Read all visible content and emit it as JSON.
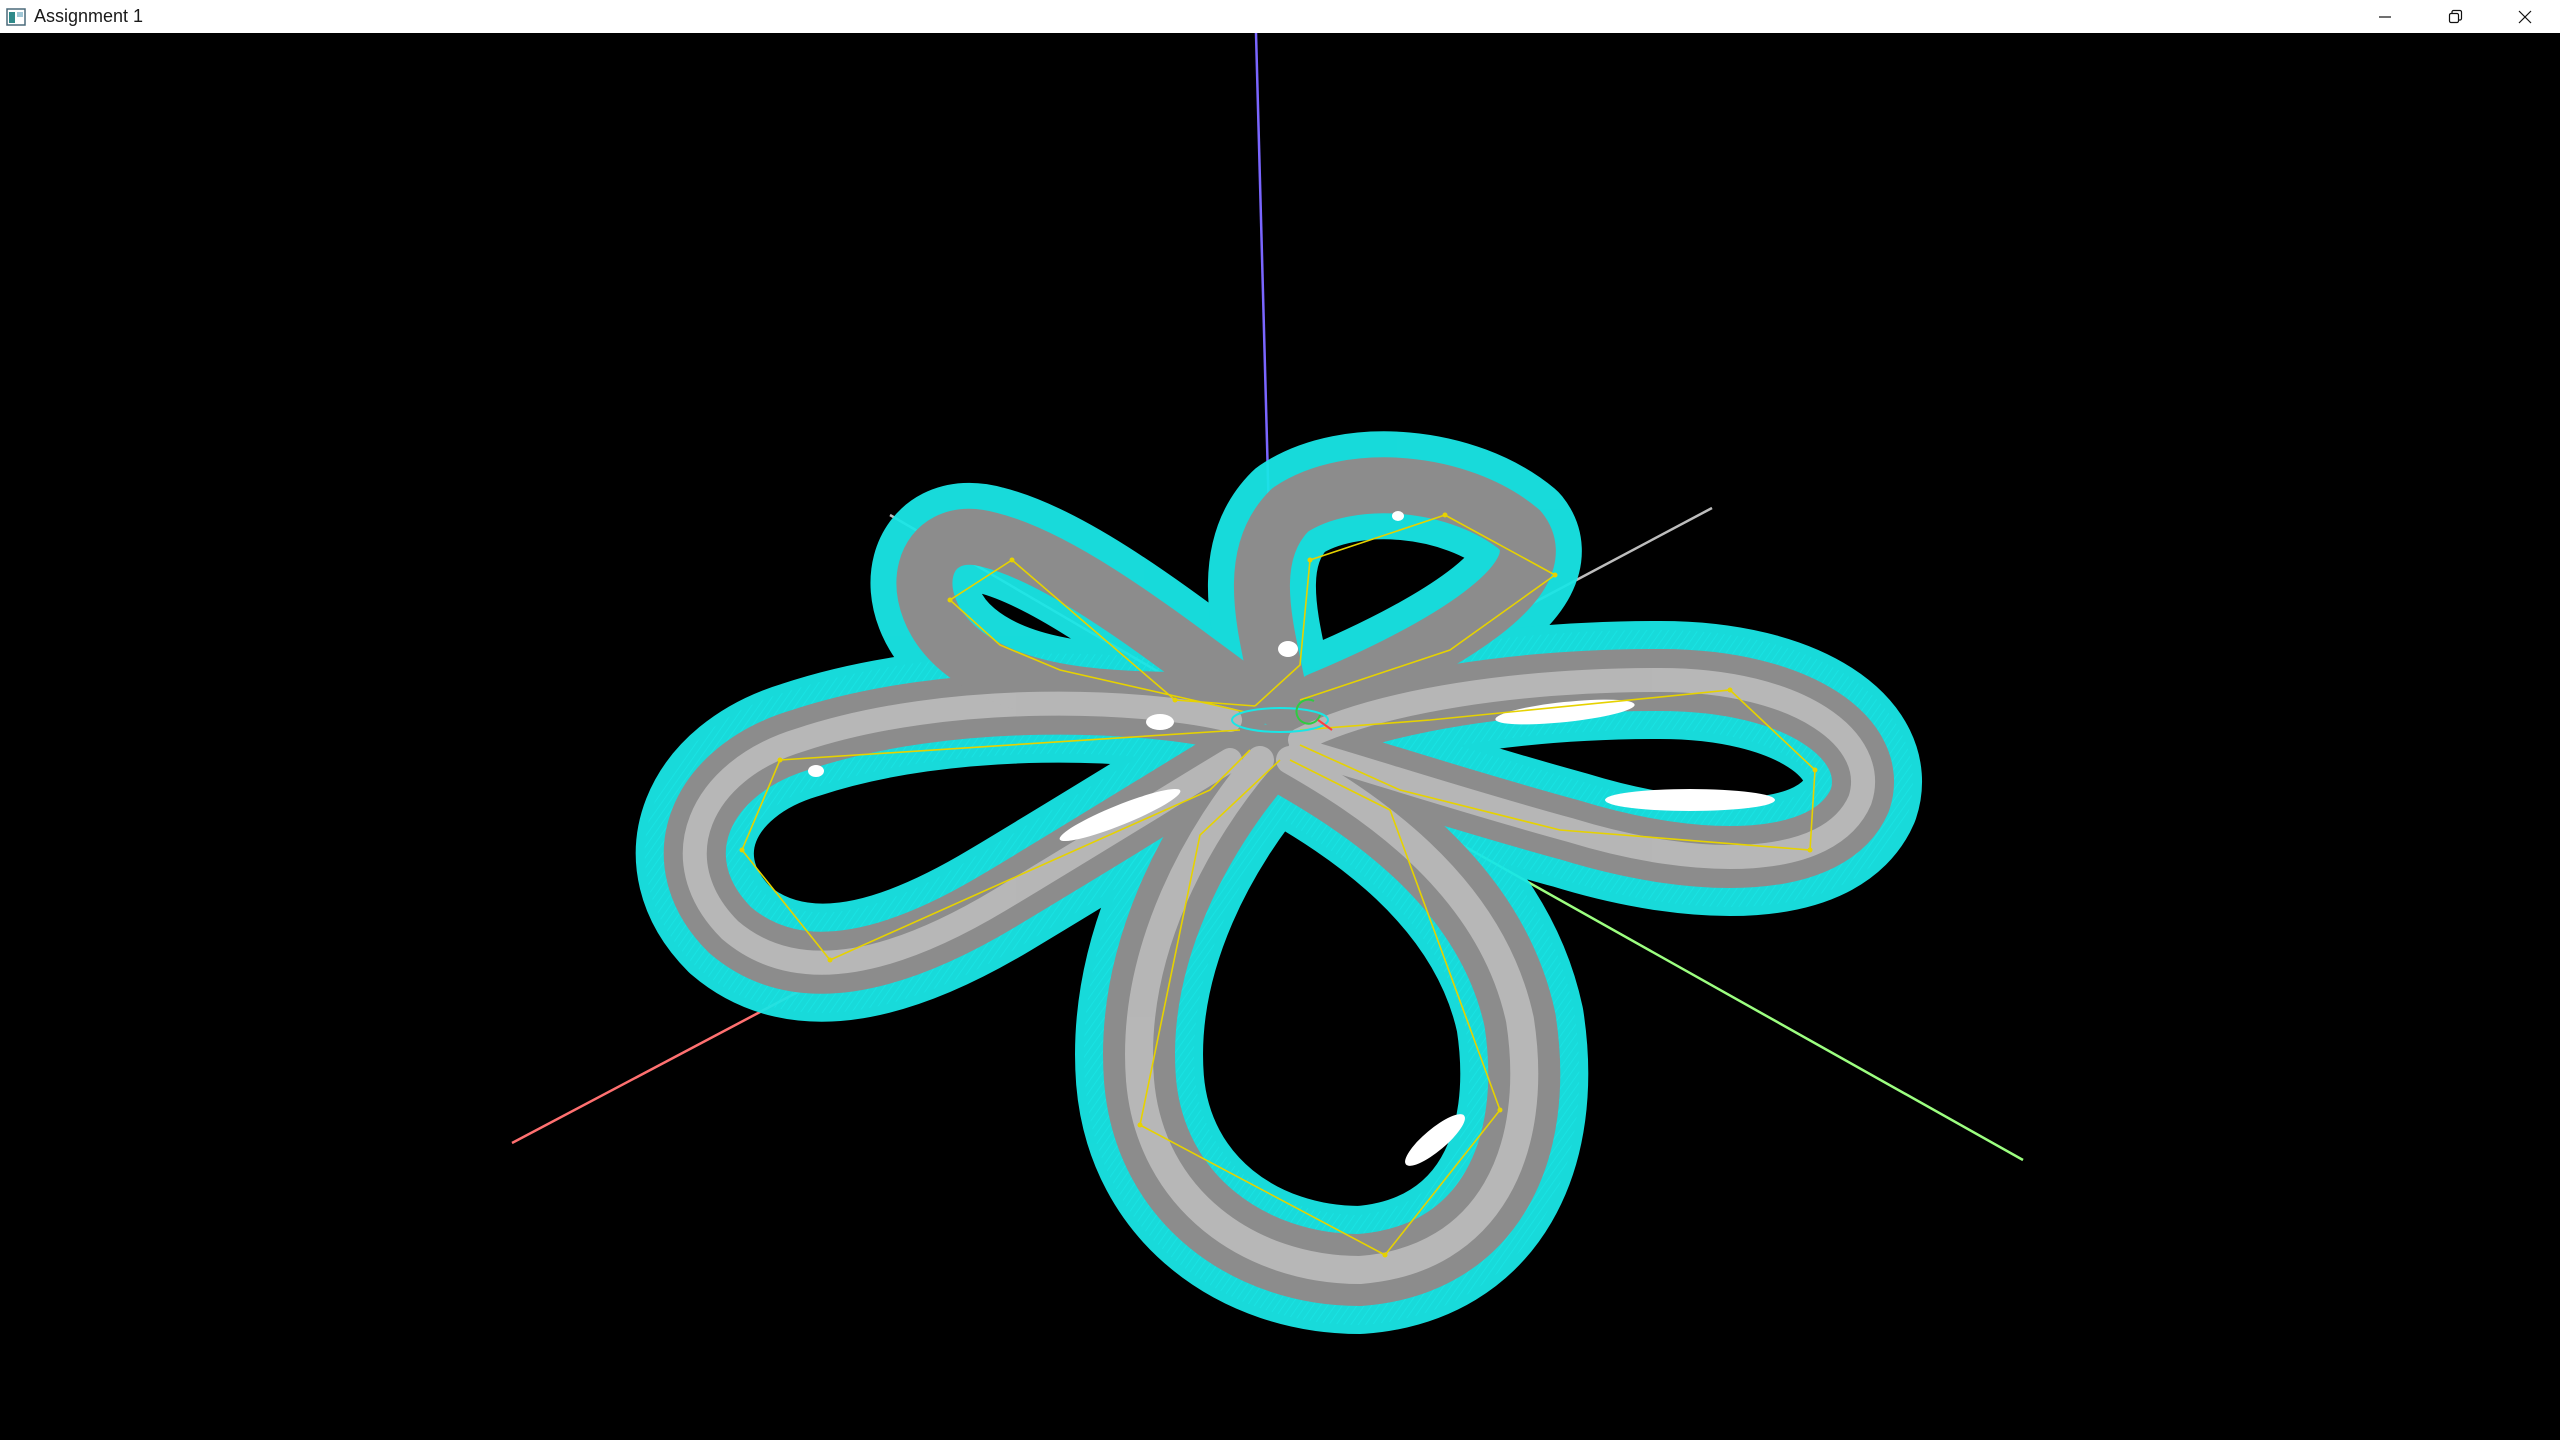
{
  "window": {
    "title": "Assignment 1",
    "app_icon": "window-app-icon",
    "controls": {
      "minimize_icon": "minimize-icon",
      "restore_icon": "restore-icon",
      "close_icon": "close-icon"
    }
  },
  "scene": {
    "background_color": "#000000",
    "surface_color": "#bdbdbd",
    "normals_color": "#19e6e6",
    "control_polygon_color": "#e6d200",
    "axes": {
      "x_color": "#ff7070",
      "y_color": "#9cff80",
      "z_color": "#7a66ff",
      "negative_color": "#bdbdbd"
    }
  }
}
